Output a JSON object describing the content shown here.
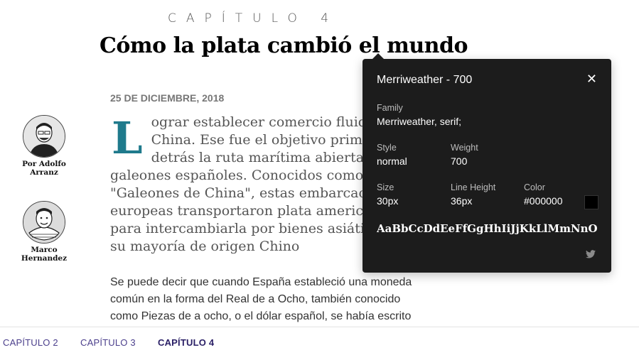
{
  "header": {
    "kicker": "CAPÍTULO 4",
    "title": "Cómo la plata cambió el mundo"
  },
  "article": {
    "date": "25 DE DICIEMBRE, 2018",
    "dropcap": "L",
    "lead": "ograr establecer comercio fluido con China. Ese fue el objetivo primordial detrás la ruta marítima abierta por los galeones españoles. Conocidos como los \"Galeones de China\", estas embarcaciones europeas transportaron plata americana para intercambiarla por bienes asiáticos, en su mayoría de origen Chino",
    "body": "Se puede decir que cuando España estableció una moneda común en la forma del Real de a Ocho, también conocido como Piezas de a ocho, o el dólar español, se había escrito el"
  },
  "authors": [
    {
      "name": "Por Adolfo Arranz"
    },
    {
      "name": "Marco Hernandez"
    }
  ],
  "font_popup": {
    "title": "Merriweather - 700",
    "close_icon": "close-icon",
    "family_label": "Family",
    "family_value": "Merriweather, serif;",
    "style_label": "Style",
    "style_value": "normal",
    "weight_label": "Weight",
    "weight_value": "700",
    "size_label": "Size",
    "size_value": "30px",
    "line_height_label": "Line Height",
    "line_height_value": "36px",
    "color_label": "Color",
    "color_value": "#000000",
    "sample": "AaBbCcDdEeFfGgHhIiJjKkLlMmNnOoPpQqRrSsTtUuVvWwXxYyZz",
    "share_icon": "twitter-icon"
  },
  "bottom_nav": [
    {
      "label": "CAPÍTULO 2",
      "active": false
    },
    {
      "label": "CAPÍTULO 3",
      "active": false
    },
    {
      "label": "CAPÍTULO 4",
      "active": true
    }
  ],
  "colors": {
    "dropcap": "#1f7a8c",
    "popup_bg": "#1c1c1c",
    "nav": "#4b3f8c"
  }
}
